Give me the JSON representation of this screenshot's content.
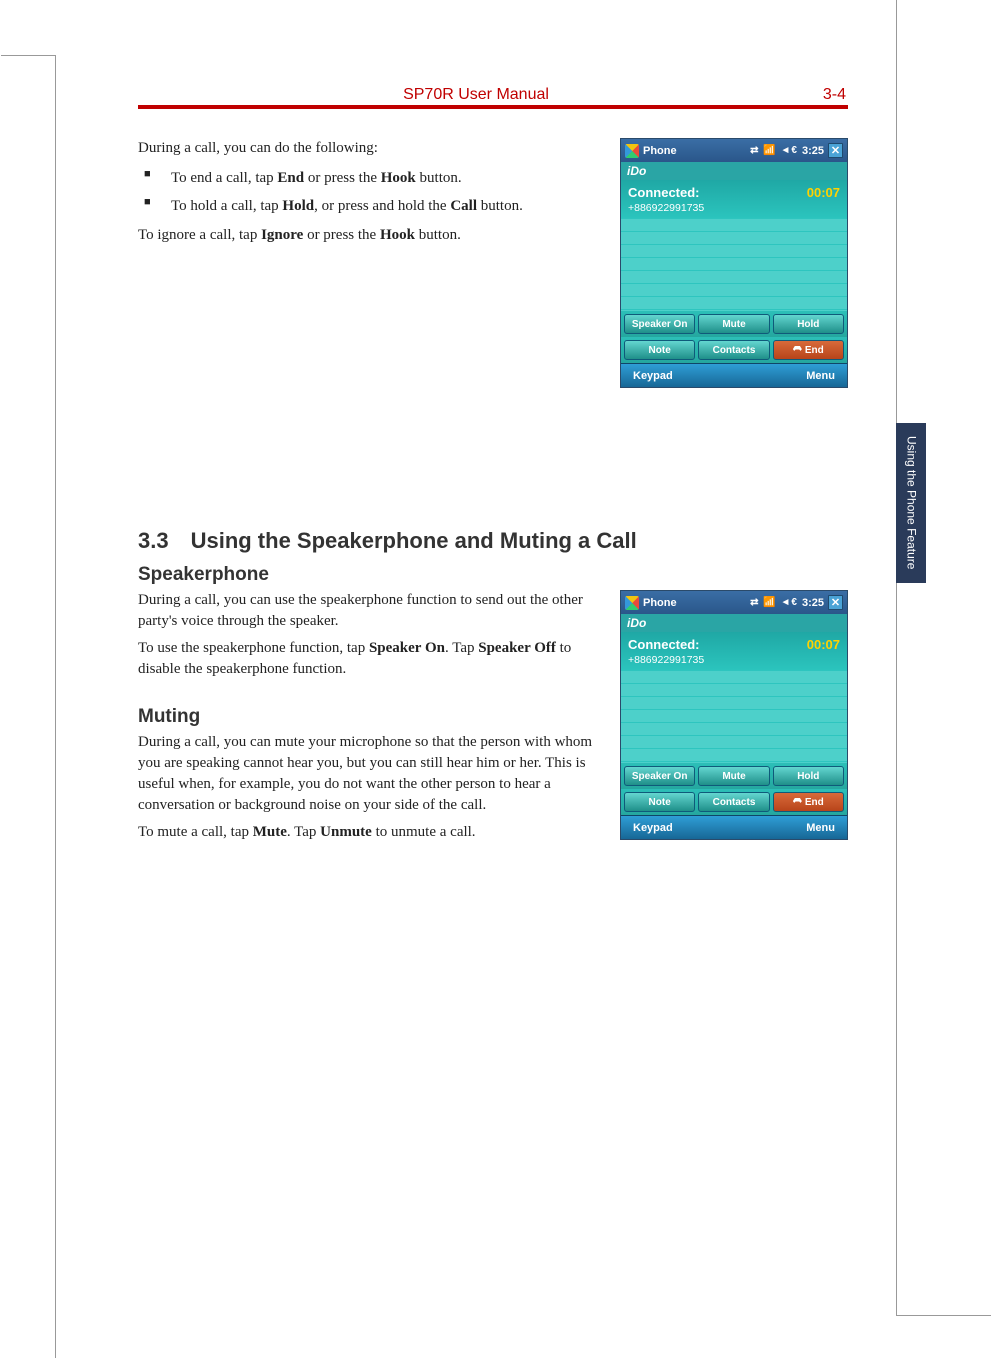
{
  "header": {
    "title": "SP70R User Manual",
    "page_num": "3-4"
  },
  "side_tab": "Using the Phone Feature",
  "intro": {
    "lead": "During a call, you can do the following:",
    "bullets": [
      {
        "pre": "To end a call, tap ",
        "b1": "End",
        "mid": " or press the ",
        "b2": "Hook",
        "post": " button."
      },
      {
        "pre": "To hold a call, tap ",
        "b1": "Hold",
        "mid": ", or press and hold the ",
        "b2": "Call",
        "post": " button."
      }
    ],
    "ignore": {
      "pre": "To ignore a call, tap ",
      "b1": "Ignore",
      "mid": " or press the ",
      "b2": "Hook",
      "post": " button."
    }
  },
  "section33": {
    "heading": "3.3 Using the Speakerphone and Muting a Call",
    "speakerphone": {
      "title": "Speakerphone",
      "p1": "During a call, you can use the speakerphone function to send out the other party's voice through the speaker.",
      "p2": {
        "pre": "To use the speakerphone function, tap ",
        "b1": "Speaker On",
        "mid": ". Tap ",
        "b2": "Speaker Off",
        "post": " to disable the speakerphone function."
      }
    },
    "muting": {
      "title": "Muting",
      "p1": "During a call, you can mute your microphone so that the person with whom you are speaking cannot hear you, but you can still hear him or her. This is useful when, for example, you do not want the other person to hear a conversation or background noise on your side of the call.",
      "p2": {
        "pre": "To mute a call, tap ",
        "b1": "Mute",
        "mid": ". Tap ",
        "b2": "Unmute",
        "post": " to unmute a call."
      }
    }
  },
  "phone": {
    "titlebar": {
      "app": "Phone",
      "time": "3:25"
    },
    "carrier": "iDo",
    "status": {
      "label": "Connected:",
      "timer": "00:07",
      "number": "+886922991735"
    },
    "buttons_row1": [
      "Speaker On",
      "Mute",
      "Hold"
    ],
    "buttons_row2": [
      "Note",
      "Contacts",
      "End"
    ],
    "bottom": {
      "left": "Keypad",
      "right": "Menu"
    }
  }
}
